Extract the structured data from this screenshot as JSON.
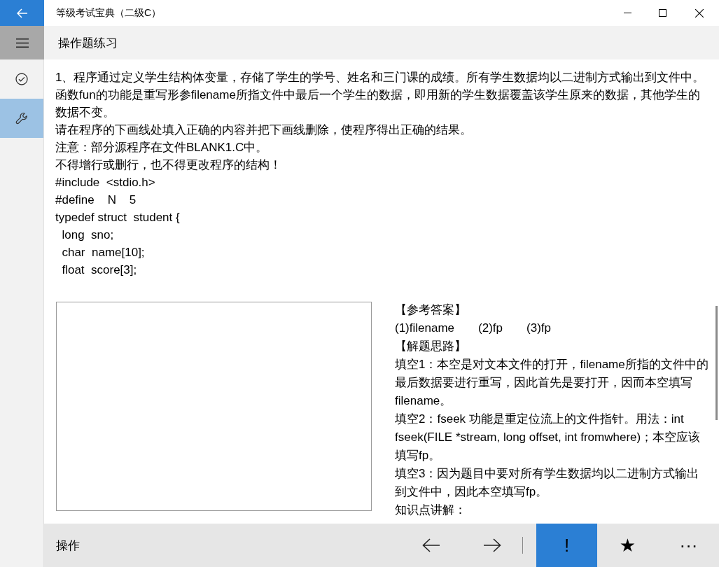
{
  "window": {
    "title": "等级考试宝典（二级C）"
  },
  "rail": {
    "items": [
      {
        "kind": "check",
        "selected": false
      },
      {
        "kind": "wrench",
        "selected": true
      }
    ]
  },
  "header": {
    "title": "操作题练习"
  },
  "question": {
    "lines": [
      "1、程序通过定义学生结构体变量，存储了学生的学号、姓名和三门课的成绩。所有学生数据均以二进制方式输出到文件中。函数fun的功能是重写形参filename所指文件中最后一个学生的数据，即用新的学生数据覆盖该学生原来的数据，其他学生的数据不变。",
      "请在程序的下画线处填入正确的内容并把下画线删除，使程序得出正确的结果。",
      "注意：部分源程序在文件BLANK1.C中。",
      "不得增行或删行，也不得更改程序的结构！",
      "#include  <stdio.h>",
      "#define    N    5",
      "typedef struct  student {",
      "  long  sno;",
      "  char  name[10];",
      "  float  score[3];"
    ]
  },
  "answer": {
    "heading": "【参考答案】",
    "blanks": [
      "(1)filename",
      "(2)fp",
      "(3)fp"
    ],
    "analysis_heading": "【解题思路】",
    "lines": [
      "填空1：本空是对文本文件的打开，filename所指的文件中的最后数据要进行重写，因此首先是要打开，因而本空填写filename。",
      "填空2：fseek 功能是重定位流上的文件指针。用法：int fseek(FILE *stream, long offset, int fromwhere)；本空应该填写fp。",
      "填空3：因为题目中要对所有学生数据均以二进制方式输出到文件中，因此本空填写fp。",
      "知识点讲解："
    ]
  },
  "bottom_bar": {
    "label": "操作",
    "actions": [
      {
        "kind": "prev"
      },
      {
        "kind": "next"
      },
      {
        "kind": "separator"
      },
      {
        "kind": "text",
        "label": "!",
        "selected": true
      },
      {
        "kind": "text",
        "label": "★",
        "selected": false
      },
      {
        "kind": "text",
        "label": "···",
        "selected": false
      }
    ]
  }
}
